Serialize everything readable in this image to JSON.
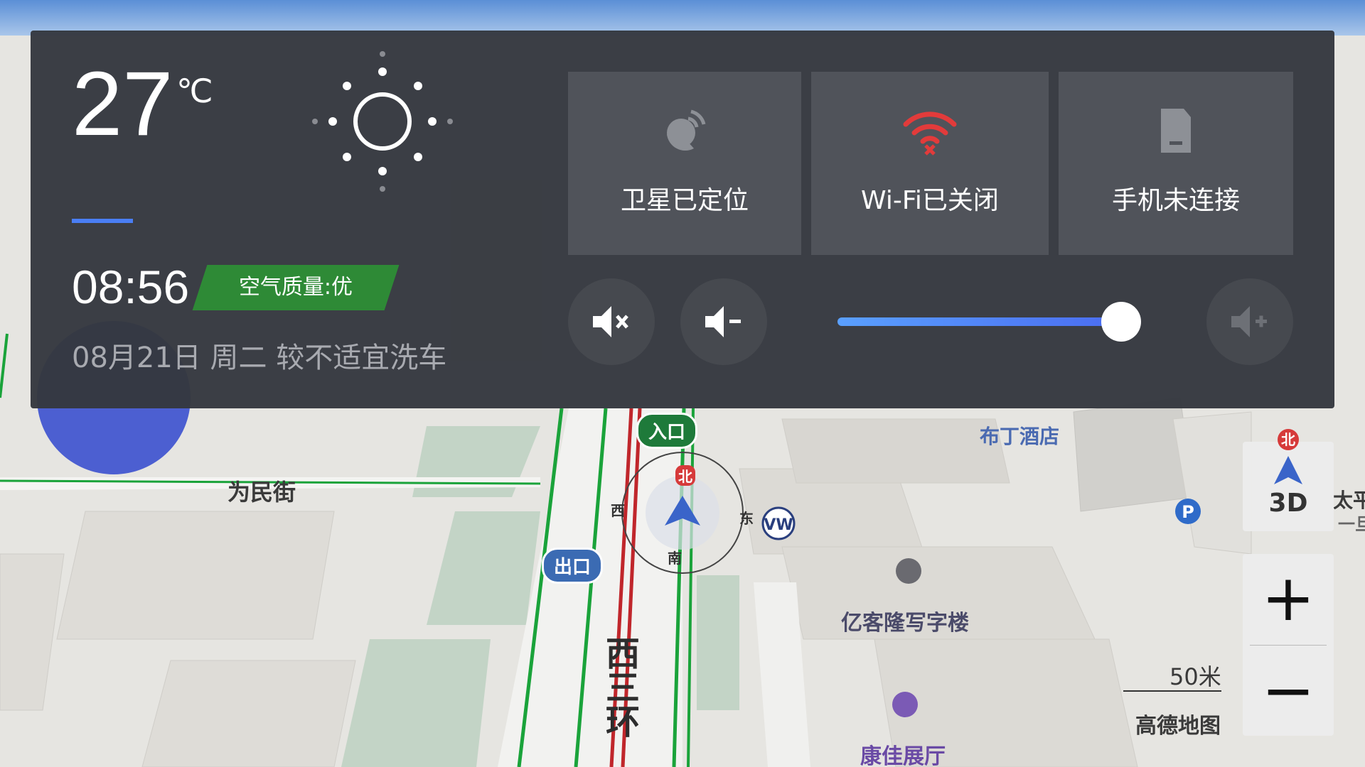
{
  "weather": {
    "temperature": "27",
    "unit": "℃",
    "icon": "sun-icon"
  },
  "clock": {
    "time": "08:56",
    "date_line": "08月21日 周二  较不适宜洗车"
  },
  "air_quality": {
    "label": "空气质量:优",
    "color": "#2e8a36"
  },
  "status_tiles": [
    {
      "label": "卫星已定位",
      "icon": "satellite-icon"
    },
    {
      "label": "Wi-Fi已关闭",
      "icon": "wifi-off-icon",
      "icon_color": "#e23b3b"
    },
    {
      "label": "手机未连接",
      "icon": "phone-icon"
    }
  ],
  "volume": {
    "level_fraction": 0.95,
    "buttons": [
      "mute-icon",
      "volume-down-icon",
      "volume-up-icon"
    ]
  },
  "map": {
    "road_west": "为民街",
    "road_vertical": "西三环",
    "entrance_badge": "入口",
    "exit_badge": "出口",
    "poi_hotel": "布丁酒店",
    "poi_office": "亿客隆写字楼",
    "poi_hall": "康佳展厅",
    "poi_edge": "太平",
    "poi_edge_sub": "一旦",
    "compass": {
      "north": "北",
      "south": "南",
      "east": "东",
      "west": "西"
    }
  },
  "controls": {
    "north_label": "北",
    "view_mode": "3D",
    "zoom_in": "+",
    "zoom_out": "−",
    "scale": "50米",
    "brand": "高德地图"
  },
  "colors": {
    "accent": "#4a7ef5",
    "panel_bg": "#34373e",
    "traffic_green": "#1aa33a",
    "traffic_red": "#c0262b"
  }
}
